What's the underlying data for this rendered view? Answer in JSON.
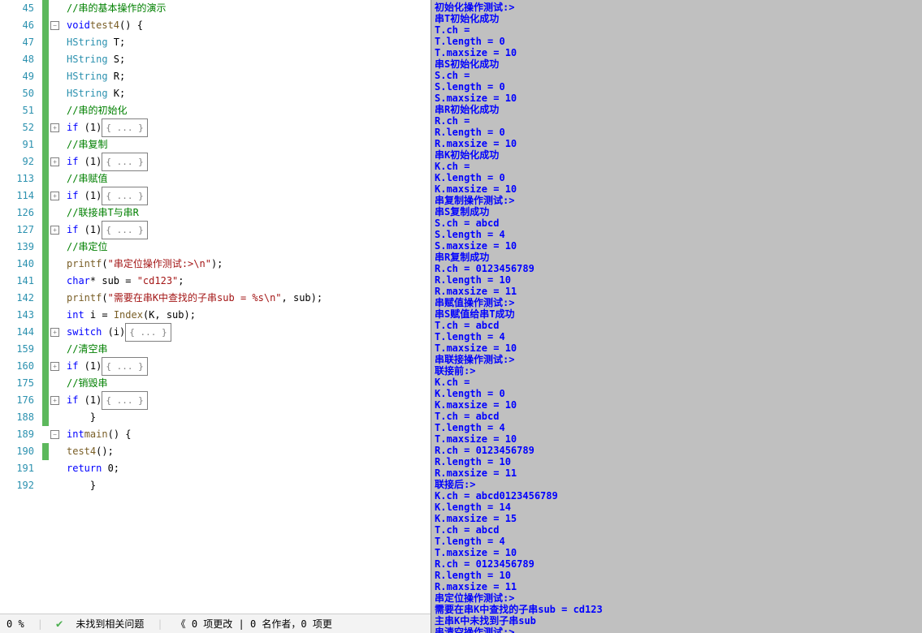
{
  "code": [
    {
      "num": 45,
      "mark": "green",
      "fold": "",
      "html": "    <span class=\"c\">//串的基本操作的演示</span>"
    },
    {
      "num": 46,
      "mark": "green",
      "fold": "-",
      "html": "    <span class=\"k\">void</span> <span class=\"fn\">test4</span>() {"
    },
    {
      "num": 47,
      "mark": "green",
      "fold": "",
      "html": "        <span class=\"t\">HString</span> T;"
    },
    {
      "num": 48,
      "mark": "green",
      "fold": "",
      "html": "        <span class=\"t\">HString</span> S;"
    },
    {
      "num": 49,
      "mark": "green",
      "fold": "",
      "html": "        <span class=\"t\">HString</span> R;"
    },
    {
      "num": 50,
      "mark": "green",
      "fold": "",
      "html": "        <span class=\"t\">HString</span> K;"
    },
    {
      "num": 51,
      "mark": "green",
      "fold": "",
      "html": "        <span class=\"c\">//串的初始化</span>"
    },
    {
      "num": 52,
      "mark": "green",
      "fold": "+",
      "html": "        <span class=\"k\">if</span> (1)<span class=\"folded\">{ ... }</span>"
    },
    {
      "num": 91,
      "mark": "green",
      "fold": "",
      "html": "        <span class=\"c\">//串复制</span>"
    },
    {
      "num": 92,
      "mark": "green",
      "fold": "+",
      "html": "        <span class=\"k\">if</span> (1)<span class=\"folded\">{ ... }</span>"
    },
    {
      "num": 113,
      "mark": "green",
      "fold": "",
      "html": "        <span class=\"c\">//串赋值</span>"
    },
    {
      "num": 114,
      "mark": "green",
      "fold": "+",
      "html": "        <span class=\"k\">if</span> (1)<span class=\"folded\">{ ... }</span>"
    },
    {
      "num": 126,
      "mark": "green",
      "fold": "",
      "html": "        <span class=\"c\">//联接串T与串R</span>"
    },
    {
      "num": 127,
      "mark": "green",
      "fold": "+",
      "html": "        <span class=\"k\">if</span> (1)<span class=\"folded\">{ ... }</span>"
    },
    {
      "num": 139,
      "mark": "green",
      "fold": "",
      "html": "        <span class=\"c\">//串定位</span>"
    },
    {
      "num": 140,
      "mark": "green",
      "fold": "",
      "html": "        <span class=\"fn\">printf</span>(<span class=\"s\">\"串定位操作测试:&gt;\\n\"</span>);"
    },
    {
      "num": 141,
      "mark": "green",
      "fold": "",
      "html": "        <span class=\"k\">char</span>* sub = <span class=\"s\">\"cd123\"</span>;"
    },
    {
      "num": 142,
      "mark": "green",
      "fold": "",
      "html": "        <span class=\"fn\">printf</span>(<span class=\"s\">\"需要在串K中查找的子串sub = %s\\n\"</span>, sub);"
    },
    {
      "num": 143,
      "mark": "green",
      "fold": "",
      "html": "        <span class=\"k\">int</span> i = <span class=\"fn\">Index</span>(K, sub);"
    },
    {
      "num": 144,
      "mark": "green",
      "fold": "+",
      "html": "        <span class=\"k\">switch</span> (i)<span class=\"folded\">{ ... }</span>"
    },
    {
      "num": 159,
      "mark": "green",
      "fold": "",
      "html": "        <span class=\"c\">//清空串</span>"
    },
    {
      "num": 160,
      "mark": "green",
      "fold": "+",
      "html": "        <span class=\"k\">if</span> (1)<span class=\"folded\">{ ... }</span>"
    },
    {
      "num": 175,
      "mark": "green",
      "fold": "",
      "html": "        <span class=\"c\">//销毁串</span>"
    },
    {
      "num": 176,
      "mark": "green",
      "fold": "+",
      "html": "        <span class=\"k\">if</span> (1)<span class=\"folded\">{ ... }</span>"
    },
    {
      "num": 188,
      "mark": "green",
      "fold": "",
      "html": "    }"
    },
    {
      "num": 189,
      "mark": "",
      "fold": "-",
      "html": "    <span class=\"k\">int</span> <span class=\"fn\">main</span>() {"
    },
    {
      "num": 190,
      "mark": "green",
      "fold": "",
      "html": "        <span class=\"fn\">test4</span>();"
    },
    {
      "num": 191,
      "mark": "",
      "fold": "",
      "html": "        <span class=\"k\">return</span> 0;"
    },
    {
      "num": 192,
      "mark": "",
      "fold": "",
      "html": "    }"
    }
  ],
  "status": {
    "zoom": "0 %",
    "issues": "未找到相关问题",
    "vcstats": "0 项更改 | 0 名作者，0 项更"
  },
  "vcprefix": "《",
  "output": "初始化操作测试:>\n串T初始化成功\nT.ch =\nT.length = 0\nT.maxsize = 10\n串S初始化成功\nS.ch =\nS.length = 0\nS.maxsize = 10\n串R初始化成功\nR.ch =\nR.length = 0\nR.maxsize = 10\n串K初始化成功\nK.ch =\nK.length = 0\nK.maxsize = 10\n串复制操作测试:>\n串S复制成功\nS.ch = abcd\nS.length = 4\nS.maxsize = 10\n串R复制成功\nR.ch = 0123456789\nR.length = 10\nR.maxsize = 11\n串赋值操作测试:>\n串S赋值给串T成功\nT.ch = abcd\nT.length = 4\nT.maxsize = 10\n串联接操作测试:>\n联接前:>\nK.ch =\nK.length = 0\nK.maxsize = 10\nT.ch = abcd\nT.length = 4\nT.maxsize = 10\nR.ch = 0123456789\nR.length = 10\nR.maxsize = 11\n联接后:>\nK.ch = abcd0123456789\nK.length = 14\nK.maxsize = 15\nT.ch = abcd\nT.length = 4\nT.maxsize = 10\nR.ch = 0123456789\nR.length = 10\nR.maxsize = 11\n串定位操作测试:>\n需要在串K中查找的子串sub = cd123\n主串K中未找到子串sub\n串清空操作测试:>\n串T已清空\n串S已清空\n串R已清空\n串K已清空\n串销毁操作测试:>\n串T、串S已销毁\n串R已销毁\n串K已销毁"
}
